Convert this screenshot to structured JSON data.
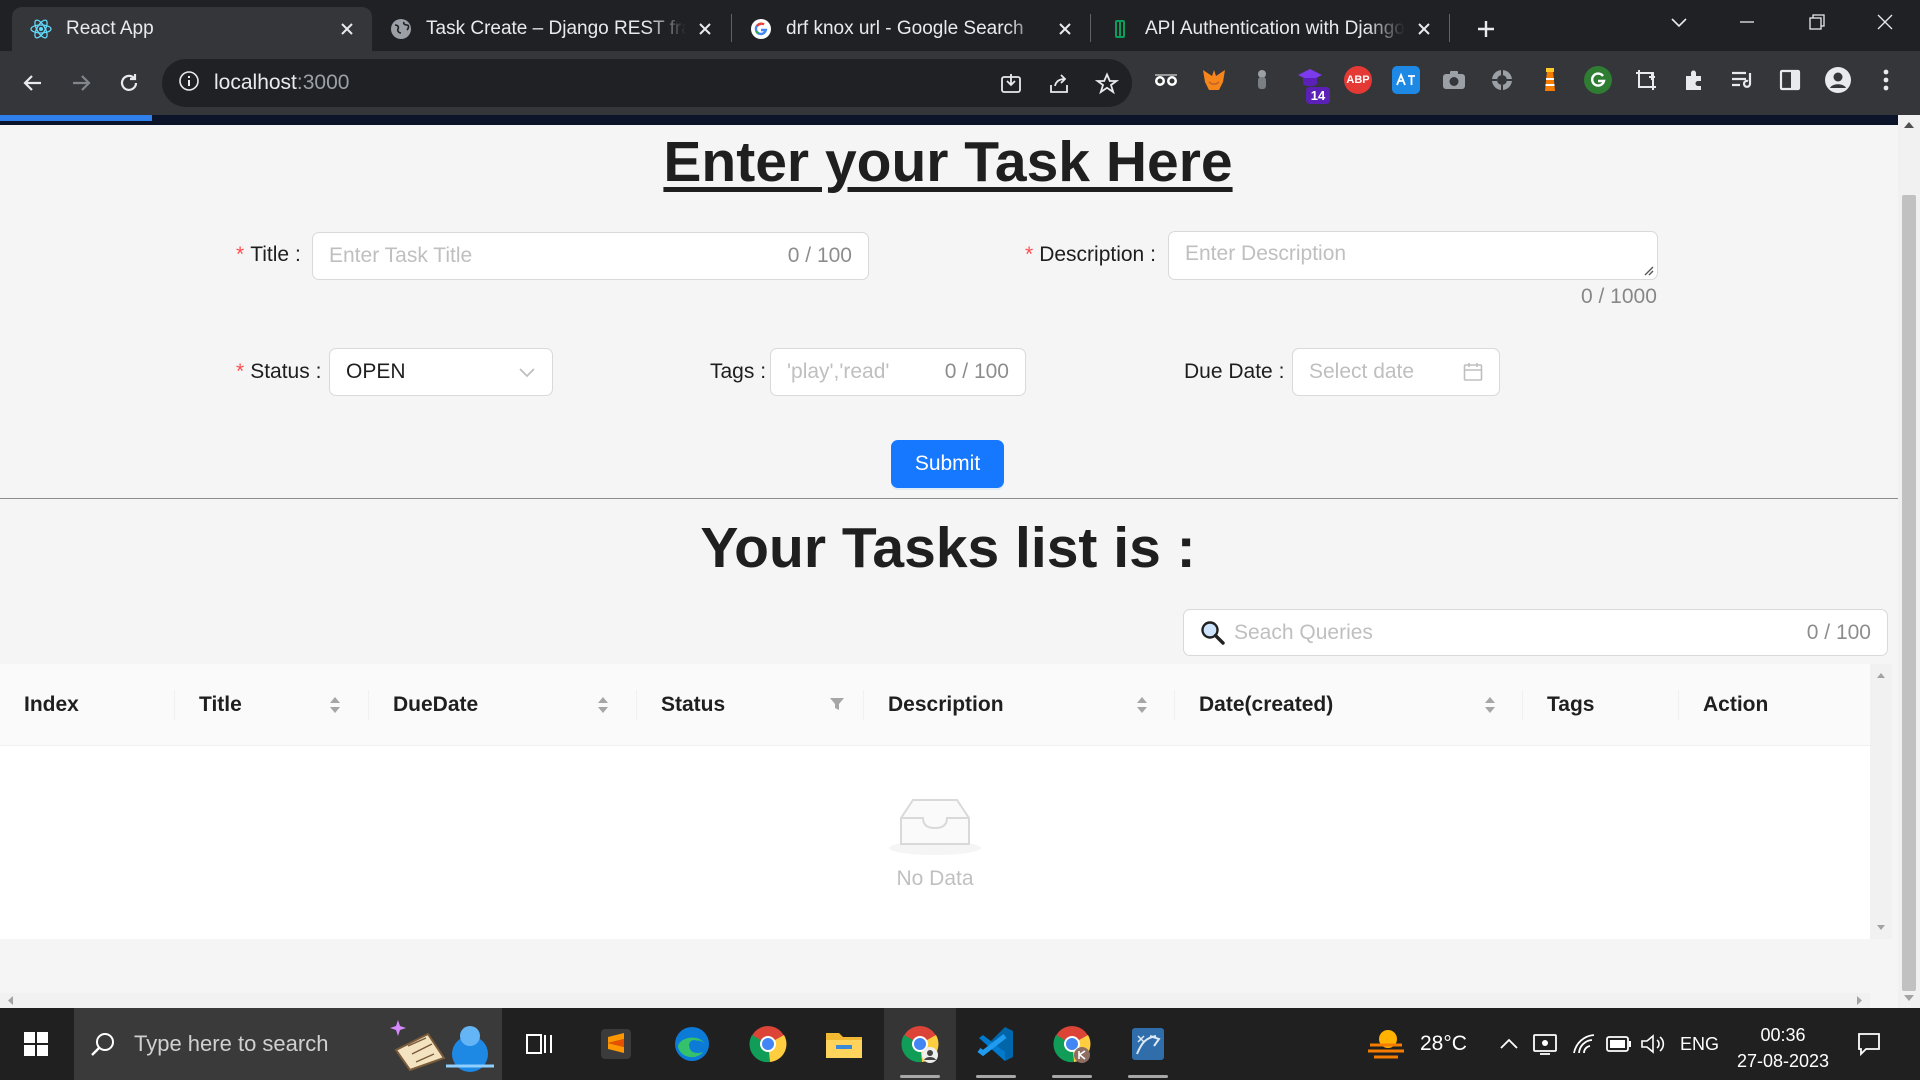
{
  "browser": {
    "tabs": [
      {
        "title": "React App",
        "favicon": "react-icon",
        "active": true
      },
      {
        "title": "Task Create – Django REST framework",
        "favicon": "globe-icon",
        "active": false
      },
      {
        "title": "drf knox url - Google Search",
        "favicon": "google-icon",
        "active": false
      },
      {
        "title": "API Authentication with Django Knox",
        "favicon": "book-icon",
        "active": false
      }
    ],
    "url_host": "localhost",
    "url_port": ":3000",
    "extension_badge": "14",
    "abp_label": "ABP"
  },
  "form": {
    "heading": "Enter your Task Here",
    "title_label": "Title",
    "title_placeholder": "Enter Task Title",
    "title_count": "0 / 100",
    "description_label": "Description",
    "description_placeholder": "Enter Description",
    "description_count": "0 / 1000",
    "status_label": "Status",
    "status_value": "OPEN",
    "tags_label": "Tags",
    "tags_placeholder": "'play','read'",
    "tags_count": "0 / 100",
    "due_date_label": "Due Date",
    "due_date_placeholder": "Select date",
    "submit_label": "Submit",
    "colon": ":",
    "required_mark": "*"
  },
  "list": {
    "heading": "Your Tasks list is :",
    "search_placeholder": "Seach Queries",
    "search_count": "0 / 100",
    "columns": [
      "Index",
      "Title",
      "DueDate",
      "Status",
      "Description",
      "Date(created)",
      "Tags",
      "Action"
    ],
    "empty_text": "No Data"
  },
  "taskbar": {
    "search_placeholder": "Type here to search",
    "temperature": "28°C",
    "language": "ENG",
    "time": "00:36",
    "date": "27-08-2023"
  },
  "colors": {
    "primary": "#1677ff",
    "required": "#ff4d4f",
    "chrome_dark": "#202124",
    "chrome_toolbar": "#35363a"
  }
}
